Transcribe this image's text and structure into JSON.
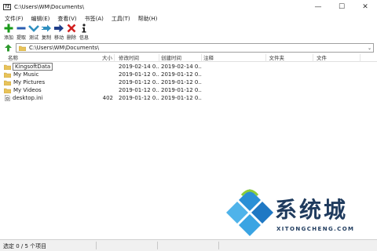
{
  "window": {
    "icon_text": "7Z",
    "title": "C:\\Users\\WM\\Documents\\",
    "minimize": "—",
    "maximize": "☐",
    "close": "✕"
  },
  "menu": [
    "文件(F)",
    "编辑(E)",
    "查看(V)",
    "书签(A)",
    "工具(T)",
    "帮助(H)"
  ],
  "toolbar": {
    "add": "添加",
    "extract": "提取",
    "test": "测试",
    "copy": "复制",
    "move": "移动",
    "delete": "删除",
    "info": "信息"
  },
  "address": {
    "path": "C:\\Users\\WM\\Documents\\"
  },
  "columns": [
    "名称",
    "大小",
    "修改时间",
    "创建时间",
    "注释",
    "文件夹",
    "文件"
  ],
  "files": [
    {
      "name": "KingsoftData",
      "size": "",
      "modified": "2019-02-14 0...",
      "created": "2019-02-14 0...",
      "type": "folder"
    },
    {
      "name": "My Music",
      "size": "",
      "modified": "2019-01-12 0...",
      "created": "2019-01-12 0...",
      "type": "folder"
    },
    {
      "name": "My Pictures",
      "size": "",
      "modified": "2019-01-12 0...",
      "created": "2019-01-12 0...",
      "type": "folder"
    },
    {
      "name": "My Videos",
      "size": "",
      "modified": "2019-01-12 0...",
      "created": "2019-01-12 0...",
      "type": "folder"
    },
    {
      "name": "desktop.ini",
      "size": "402",
      "modified": "2019-01-12 0...",
      "created": "2019-01-12 0...",
      "type": "file"
    }
  ],
  "status": {
    "selection": "选定 0 / 5 个项目"
  },
  "watermark": {
    "text": "系统城",
    "url": "XITONGCHENG.COM"
  },
  "colors": {
    "folder": "#e8c35a",
    "add": "#1a9a1a",
    "extract": "#2a5db0",
    "test": "#2f8fbf",
    "delete": "#d12020",
    "watermark_blue": "#2a8fd6",
    "watermark_text": "#1f3b5e"
  }
}
